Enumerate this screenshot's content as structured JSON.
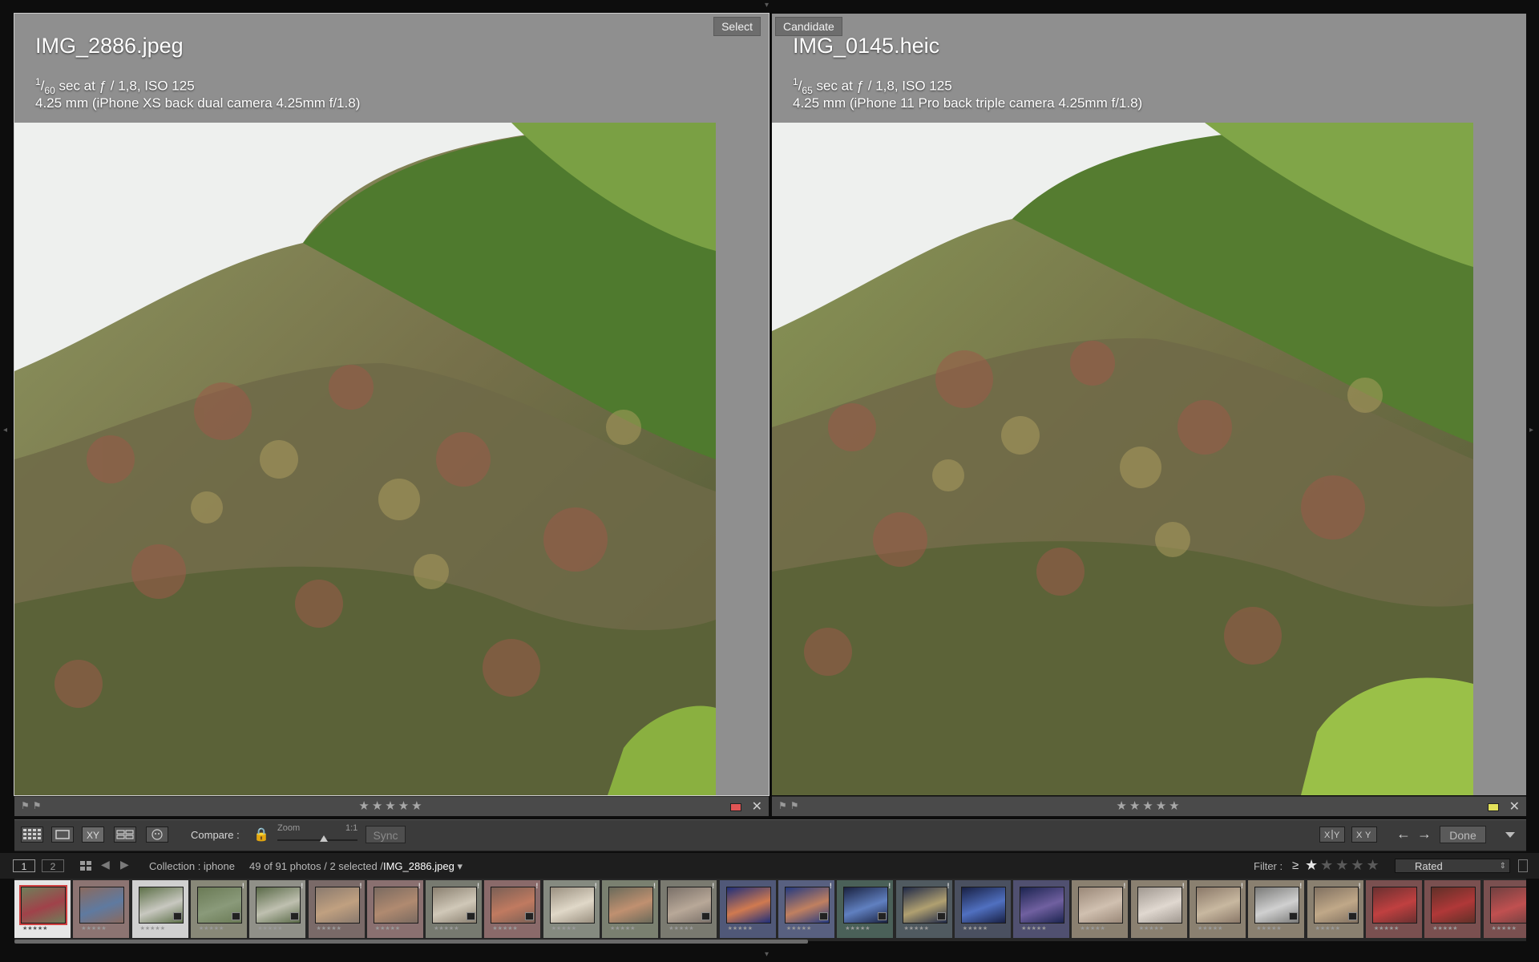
{
  "panes": {
    "left": {
      "badge": "Select",
      "filename": "IMG_2886.jpeg",
      "shutter_num": "1",
      "shutter_den": "60",
      "exposure_rest": " sec at ƒ / 1,8, ISO 125",
      "lens": "4.25 mm (iPhone XS back dual camera 4.25mm f/1.8)",
      "stars": "★★★★★",
      "flags": "⚑⚑",
      "color_label": "#e05555",
      "close": "✕"
    },
    "right": {
      "badge": "Candidate",
      "filename": "IMG_0145.heic",
      "shutter_num": "1",
      "shutter_den": "65",
      "exposure_rest": " sec at ƒ / 1,8, ISO 125",
      "lens": "4.25 mm (iPhone 11 Pro back triple camera 4.25mm f/1.8)",
      "stars": "★★★★★",
      "flags": "⚑⚑",
      "color_label": "#e3e25a",
      "close": "✕"
    }
  },
  "toolbar": {
    "grid_icon": "grid-icon",
    "loupe_icon": "loupe-icon",
    "compare_xy": "XY",
    "survey_icon": "survey-icon",
    "people_icon": "people-icon",
    "compare_label": "Compare :",
    "zoom_label": "Zoom",
    "zoom_max": "1:1",
    "zoom_level": 0.5,
    "sync_label": "Sync",
    "swap_label": "X|Y",
    "make_select_label": "XY",
    "prev_arrow": "←",
    "next_arrow": "→",
    "done_label": "Done"
  },
  "filmstrip_bar": {
    "monitor1": "1",
    "monitor2": "2",
    "collection": "Collection : iphone",
    "count": "49 of 91 photos / 2 selected /",
    "current_file": "IMG_2886.jpeg",
    "dropdown_arrow": "▾",
    "filter_label": "Filter :",
    "filter_op": "≥",
    "filter_stars_on": "★",
    "filter_stars_off": "★★★★",
    "filter_mode": "Rated",
    "select_arrow": "⇕"
  },
  "filmstrip": {
    "thumb_stars": "★★★★★",
    "bang": "!",
    "thumbs": [
      {
        "bg": "#6f7f5a",
        "tone": "#a0424a"
      },
      {
        "bg": "#8a6a5f",
        "tone": "#5f7aa0"
      },
      {
        "bg": "#5d7048",
        "tone": "#c8c8c0"
      },
      {
        "bg": "#6a7a55",
        "tone": "#8a9a7a"
      },
      {
        "bg": "#5a6a48",
        "tone": "#bfc0b0"
      },
      {
        "bg": "#8a7a6e",
        "tone": "#c0a080"
      },
      {
        "bg": "#7a6a60",
        "tone": "#b08a70"
      },
      {
        "bg": "#8a8070",
        "tone": "#d0c8b8"
      },
      {
        "bg": "#7a5f55",
        "tone": "#c07a60"
      },
      {
        "bg": "#9a9080",
        "tone": "#e0d8c8"
      },
      {
        "bg": "#6a6a5a",
        "tone": "#c09070"
      },
      {
        "bg": "#7a7068",
        "tone": "#b8a898"
      },
      {
        "bg": "#1f2f7a",
        "tone": "#d07a50"
      },
      {
        "bg": "#243a80",
        "tone": "#c08060"
      },
      {
        "bg": "#1a2240",
        "tone": "#6080c0"
      },
      {
        "bg": "#202a48",
        "tone": "#b0a070"
      },
      {
        "bg": "#182044",
        "tone": "#5070c0"
      },
      {
        "bg": "#1c2450",
        "tone": "#7060a0"
      },
      {
        "bg": "#9a8878",
        "tone": "#d0c0b0"
      },
      {
        "bg": "#a09890",
        "tone": "#e0d8d0"
      },
      {
        "bg": "#8a7868",
        "tone": "#c8b8a0"
      },
      {
        "bg": "#7a7a78",
        "tone": "#d0d0d0"
      },
      {
        "bg": "#807060",
        "tone": "#c0a888"
      },
      {
        "bg": "#6a3030",
        "tone": "#c04040"
      },
      {
        "bg": "#603028",
        "tone": "#b03838"
      },
      {
        "bg": "#704040",
        "tone": "#c05050"
      }
    ]
  }
}
